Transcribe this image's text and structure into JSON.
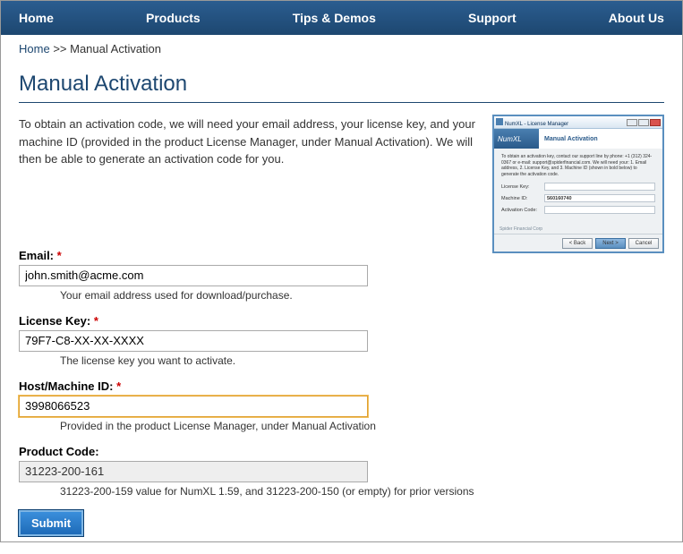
{
  "nav": {
    "items": [
      "Home",
      "Products",
      "Tips & Demos",
      "Support",
      "About Us"
    ]
  },
  "breadcrumb": {
    "home": "Home",
    "sep": ">>",
    "current": "Manual Activation"
  },
  "page": {
    "title": "Manual Activation",
    "intro": "To obtain an activation code, we will need your email address, your license key, and your machine ID (provided in the product License Manager, under Manual Activation). We will then be able to generate an activation code for you."
  },
  "dialog": {
    "title": "NumXL - License Manager",
    "logo": "NumXL",
    "header": "Manual Activation",
    "desc": "To obtain an activation key, contact our support line by phone: +1 (312) 324-0367 or e-mail: support@spiderfinancial.com. We will need your: 1. Email address, 2. License Key, and 3. Machine ID (shown in bold below) to generate the activation code.",
    "rows": {
      "license_label": "License Key:",
      "license_value": "",
      "machine_label": "Machine ID:",
      "machine_value": "560160740",
      "activation_label": "Activation Code:",
      "activation_value": ""
    },
    "corp": "Spider Financial Corp",
    "buttons": {
      "back": "< Back",
      "next": "Next >",
      "cancel": "Cancel"
    }
  },
  "form": {
    "email": {
      "label": "Email:",
      "value": "john.smith@acme.com",
      "help": "Your email address used for download/purchase."
    },
    "license": {
      "label": "License Key:",
      "value": "79F7-C8-XX-XX-XXXX",
      "help": "The license key you want to activate."
    },
    "machine": {
      "label": "Host/Machine ID:",
      "value": "3998066523",
      "help": "Provided in the product License Manager, under Manual Activation"
    },
    "product": {
      "label": "Product Code:",
      "value": "31223-200-161",
      "help": "31223-200-159 value for NumXL 1.59, and 31223-200-150 (or empty) for prior versions"
    },
    "submit": "Submit",
    "required_mark": "*"
  }
}
